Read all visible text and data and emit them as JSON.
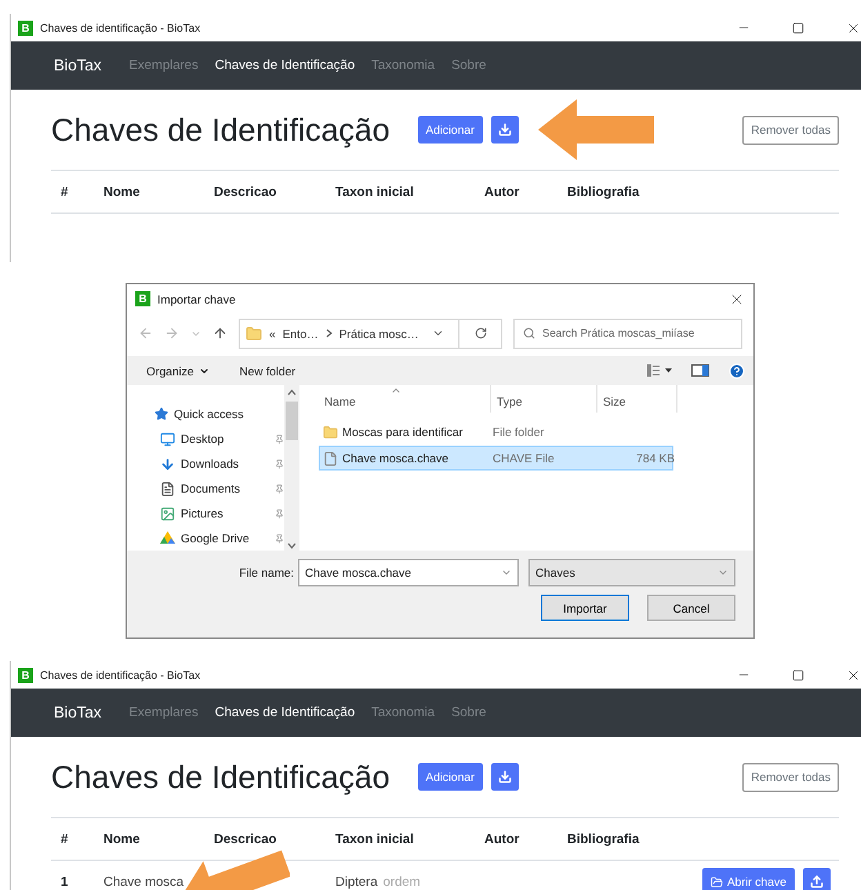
{
  "screens": [
    {
      "kind": "app",
      "title": "Chaves de identificação - BioTax",
      "icon_letter": "B",
      "nav": {
        "brand": "BioTax",
        "links": [
          {
            "label": "Exemplares",
            "selected": false
          },
          {
            "label": "Chaves de Identificação",
            "selected": true
          },
          {
            "label": "Taxonomia",
            "selected": false
          },
          {
            "label": "Sobre",
            "selected": false
          }
        ]
      },
      "heading": "Chaves de Identificação",
      "add_button": "Adicionar",
      "remove_all_button": "Remover todas",
      "columns": [
        "#",
        "Nome",
        "Descricao",
        "Taxon inicial",
        "Autor",
        "Bibliografia"
      ]
    },
    {
      "kind": "dialog",
      "title": "Importar chave",
      "icon_letter": "B",
      "address": {
        "overflow_marker": "«",
        "segments": [
          "Ento…",
          "Prática mosc…"
        ]
      },
      "search": {
        "placeholder": "Search Prática moscas_miíase"
      },
      "toolbar": {
        "organize": "Organize",
        "new_folder": "New folder"
      },
      "sidebar": [
        {
          "label": "Quick access",
          "kind": "star"
        },
        {
          "label": "Desktop",
          "kind": "desktop"
        },
        {
          "label": "Downloads",
          "kind": "downloads"
        },
        {
          "label": "Documents",
          "kind": "documents"
        },
        {
          "label": "Pictures",
          "kind": "pictures"
        },
        {
          "label": "Google Drive",
          "kind": "drive"
        }
      ],
      "columns": [
        "Name",
        "Type",
        "Size"
      ],
      "files": [
        {
          "name": "Moscas para identificar",
          "type": "File folder",
          "kind": "folder",
          "selected": false
        },
        {
          "name": "Chave mosca.chave",
          "type": "CHAVE File",
          "size": "784 KB",
          "kind": "file",
          "selected": true
        }
      ],
      "file_name_label": "File name:",
      "file_name": "Chave mosca.chave",
      "filter": "Chaves",
      "buttons": [
        {
          "label": "Importar",
          "default": true
        },
        {
          "label": "Cancel",
          "default": false
        }
      ]
    },
    {
      "kind": "app",
      "title": "Chaves de identificação - BioTax",
      "icon_letter": "B",
      "nav": {
        "brand": "BioTax",
        "links": [
          {
            "label": "Exemplares",
            "selected": false
          },
          {
            "label": "Chaves de Identificação",
            "selected": true
          },
          {
            "label": "Taxonomia",
            "selected": false
          },
          {
            "label": "Sobre",
            "selected": false
          }
        ]
      },
      "heading": "Chaves de Identificação",
      "add_button": "Adicionar",
      "remove_all_button": "Remover todas",
      "columns": [
        "#",
        "Nome",
        "Descricao",
        "Taxon inicial",
        "Autor",
        "Bibliografia"
      ],
      "rows": [
        {
          "number": "1",
          "name": "Chave mosca",
          "taxon": "Diptera",
          "taxon_rank": "ordem",
          "open_button": "Abrir chave"
        }
      ]
    }
  ]
}
